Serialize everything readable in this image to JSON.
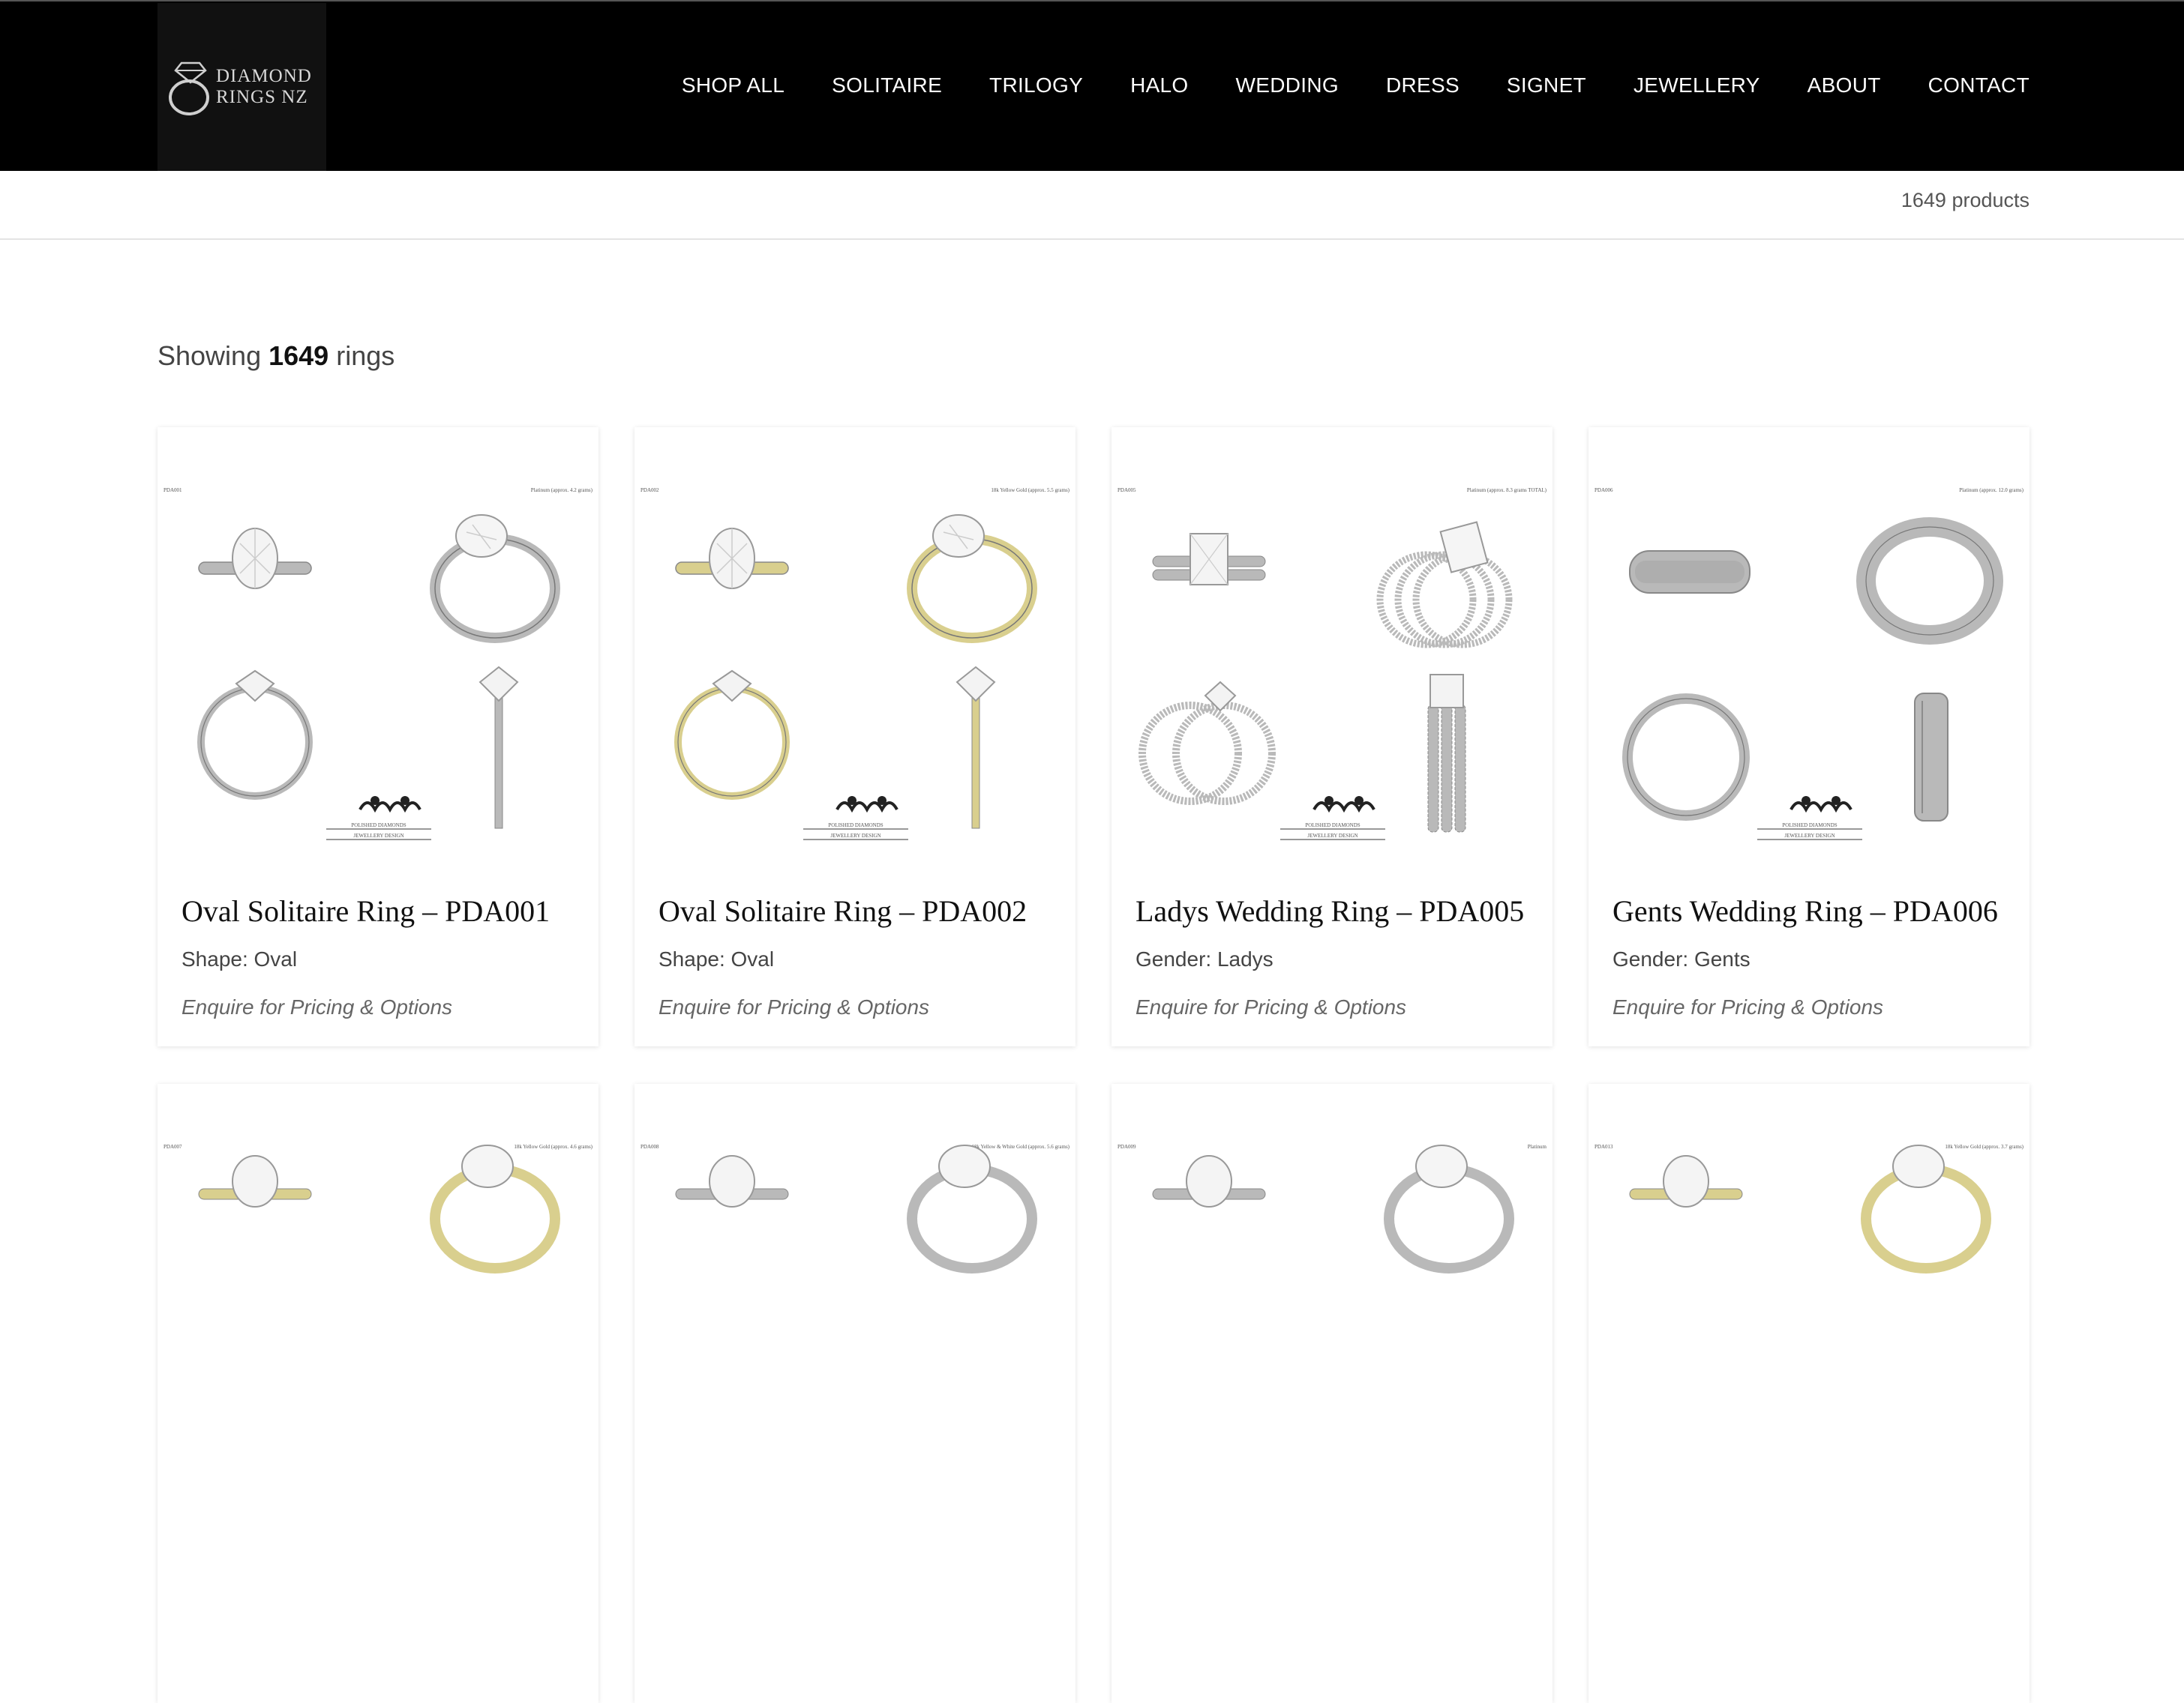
{
  "brand": {
    "logo_line1": "DIAMOND",
    "logo_line2": "RINGS NZ",
    "icon": "diamond-ring-logo-icon"
  },
  "nav": {
    "items": [
      {
        "label": "SHOP ALL"
      },
      {
        "label": "SOLITAIRE"
      },
      {
        "label": "TRILOGY"
      },
      {
        "label": "HALO"
      },
      {
        "label": "WEDDING"
      },
      {
        "label": "DRESS"
      },
      {
        "label": "SIGNET"
      },
      {
        "label": "JEWELLERY"
      },
      {
        "label": "ABOUT"
      },
      {
        "label": "CONTACT"
      }
    ]
  },
  "results": {
    "product_count": "1649 products",
    "showing_prefix": "Showing",
    "showing_count": "1649",
    "showing_suffix": "rings"
  },
  "products": [
    {
      "title": "Oval Solitaire Ring – PDA001",
      "attribute": "Shape: Oval",
      "cta": "Enquire for Pricing & Options",
      "code_label": "PDA001",
      "metal_label": "Platinum (approx. 4.2 grams)",
      "metal": "platinum",
      "style": "solitaire"
    },
    {
      "title": "Oval Solitaire Ring – PDA002",
      "attribute": "Shape: Oval",
      "cta": "Enquire for Pricing & Options",
      "code_label": "PDA002",
      "metal_label": "18k Yellow Gold (approx. 5.5 grams)",
      "metal": "yellow",
      "style": "solitaire"
    },
    {
      "title": "Ladys Wedding Ring – PDA005",
      "attribute": "Gender: Ladys",
      "cta": "Enquire for Pricing & Options",
      "code_label": "PDA005",
      "metal_label": "Platinum (approx. 8.3 grams TOTAL)",
      "metal": "platinum",
      "style": "wedding-set"
    },
    {
      "title": "Gents Wedding Ring – PDA006",
      "attribute": "Gender: Gents",
      "cta": "Enquire for Pricing & Options",
      "code_label": "PDA006",
      "metal_label": "Platinum (approx. 12.0 grams)",
      "metal": "platinum",
      "style": "band"
    }
  ],
  "next_row": [
    {
      "code_label": "PDA007",
      "metal_label": "18k Yellow Gold (approx. 4.6 grams)",
      "metal": "yellow"
    },
    {
      "code_label": "PDA008",
      "metal_label": "18k Yellow & White Gold (approx. 5.6 grams)",
      "metal": "platinum"
    },
    {
      "code_label": "PDA009",
      "metal_label": "Platinum",
      "metal": "platinum"
    },
    {
      "code_label": "PDA013",
      "metal_label": "18k Yellow Gold (approx. 3.7 grams)",
      "metal": "yellow"
    }
  ],
  "watermark": {
    "line1": "POLISHED DIAMONDS",
    "line2": "JEWELLERY DESIGN"
  },
  "colors": {
    "header_bg": "#000000",
    "platinum": "#b9b9b9",
    "yellow_gold": "#d9cf8e"
  }
}
